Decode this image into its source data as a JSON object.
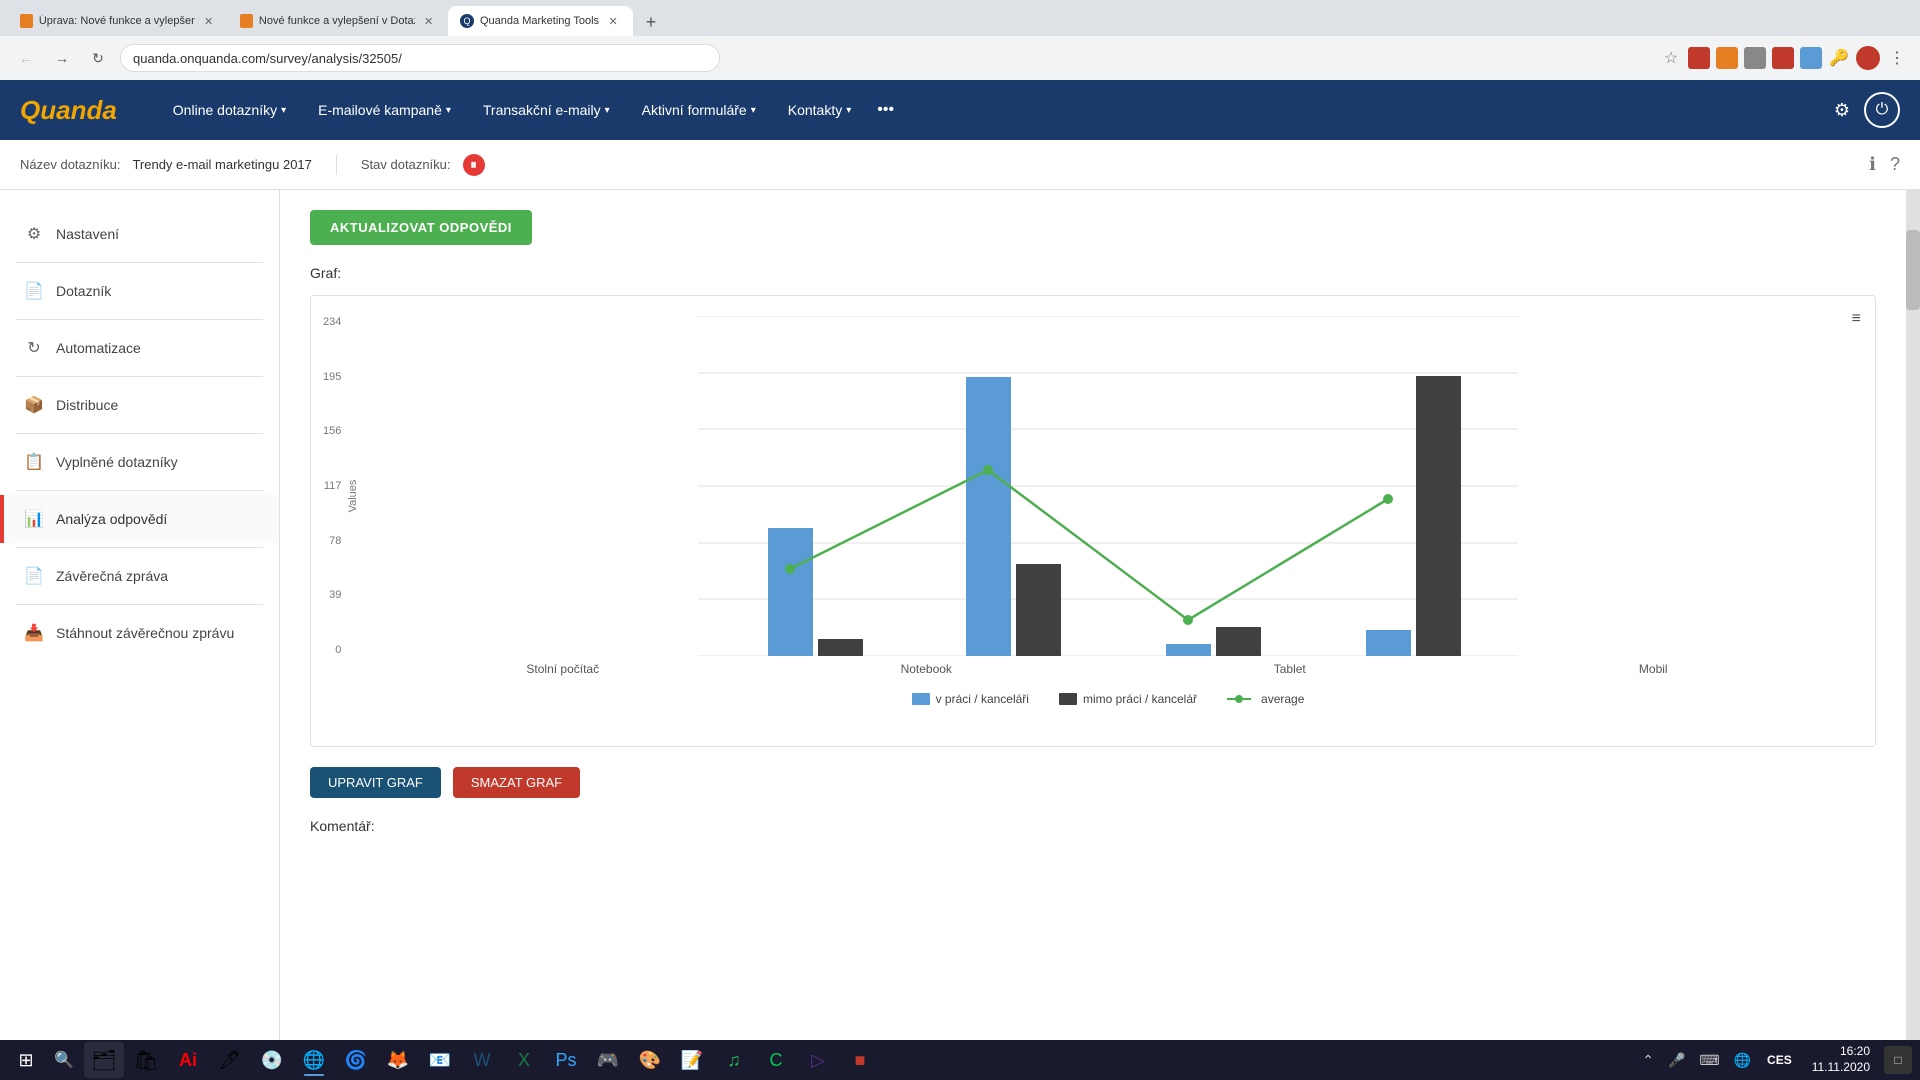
{
  "browser": {
    "tabs": [
      {
        "label": "Úprava: Nové funkce a vylepšení...",
        "active": false,
        "favicon": "page"
      },
      {
        "label": "Nové funkce a vylepšení v Dotaz...",
        "active": false,
        "favicon": "page"
      },
      {
        "label": "Quanda Marketing Tools",
        "active": true,
        "favicon": "q"
      }
    ],
    "address": "quanda.onquanda.com/survey/analysis/32505/"
  },
  "header": {
    "logo": "Quanda",
    "nav": [
      {
        "label": "Online dotazníky",
        "hasDropdown": true
      },
      {
        "label": "E-mailové kampaně",
        "hasDropdown": true
      },
      {
        "label": "Transakční e-maily",
        "hasDropdown": true
      },
      {
        "label": "Aktivní formuláře",
        "hasDropdown": true
      },
      {
        "label": "Kontakty",
        "hasDropdown": true
      }
    ]
  },
  "subheader": {
    "nazev_label": "Název dotazníku:",
    "nazev_value": "Trendy e-mail marketingu 2017",
    "stav_label": "Stav dotazníku:",
    "stav_icon": "pause"
  },
  "sidebar": {
    "items": [
      {
        "id": "nastaveni",
        "label": "Nastavení",
        "icon": "⚙",
        "active": false
      },
      {
        "id": "dotaznik",
        "label": "Dotazník",
        "icon": "📄",
        "active": false
      },
      {
        "id": "automatizace",
        "label": "Automatizace",
        "icon": "↻",
        "active": false
      },
      {
        "id": "distribuce",
        "label": "Distribuce",
        "icon": "📦",
        "active": false
      },
      {
        "id": "vyplnene",
        "label": "Vyplněné dotazníky",
        "icon": "📋",
        "active": false
      },
      {
        "id": "analyza",
        "label": "Analýza odpovědí",
        "icon": "📊",
        "active": true
      },
      {
        "id": "zaverecna",
        "label": "Závěrečná zpráva",
        "icon": "📄",
        "active": false
      },
      {
        "id": "stahnout",
        "label": "Stáhnout závěrečnou zprávu",
        "icon": "📥",
        "active": false
      }
    ]
  },
  "content": {
    "update_btn": "AKTUALIZOVAT ODPOVĚDI",
    "graf_label": "Graf:",
    "chart_menu_icon": "≡",
    "y_labels": [
      "234",
      "195",
      "156",
      "117",
      "78",
      "39",
      "0"
    ],
    "x_labels": [
      "Stolní počítač",
      "Notebook",
      "Tablet",
      "Mobil"
    ],
    "values_axis": "Values",
    "bars": {
      "stolni": {
        "blue": 88,
        "dark": 12
      },
      "notebook": {
        "blue": 192,
        "dark": 63
      },
      "tablet": {
        "blue": 8,
        "dark": 20
      },
      "mobil": {
        "blue": 18,
        "dark": 193
      }
    },
    "legend": [
      {
        "label": "v práci / kanceláři",
        "type": "bar",
        "color": "#5b9bd5"
      },
      {
        "label": "mimo práci / kancelář",
        "type": "bar",
        "color": "#404040"
      },
      {
        "label": "average",
        "type": "line",
        "color": "#4caf50"
      }
    ],
    "edit_btn": "UPRAVIT GRAF",
    "delete_btn": "SMAZAT GRAF",
    "koment_label": "Komentář:"
  },
  "taskbar": {
    "time": "16:20",
    "date": "11.11.2020",
    "lang": "CES"
  }
}
